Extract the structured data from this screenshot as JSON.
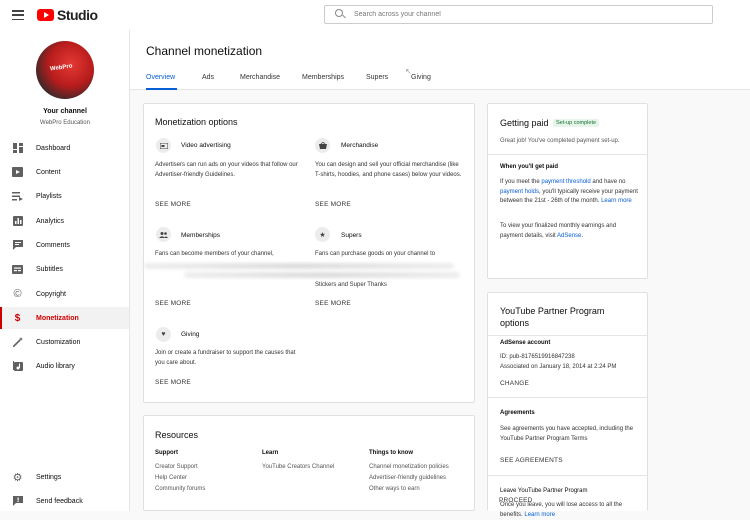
{
  "app": {
    "logo_text": "Studio"
  },
  "search": {
    "placeholder": "Search across your channel"
  },
  "channel": {
    "name": "Your channel",
    "subtitle": "WebPro Education",
    "avatar_text": "WebPro"
  },
  "sidebar": {
    "items": [
      {
        "label": "Dashboard",
        "icon": "dashboard-icon"
      },
      {
        "label": "Content",
        "icon": "content-icon"
      },
      {
        "label": "Playlists",
        "icon": "playlists-icon"
      },
      {
        "label": "Analytics",
        "icon": "analytics-icon"
      },
      {
        "label": "Comments",
        "icon": "comments-icon"
      },
      {
        "label": "Subtitles",
        "icon": "subtitles-icon"
      },
      {
        "label": "Copyright",
        "icon": "copyright-icon"
      },
      {
        "label": "Monetization",
        "icon": "dollar-icon",
        "active": true
      },
      {
        "label": "Customization",
        "icon": "magic-wand-icon"
      },
      {
        "label": "Audio library",
        "icon": "audio-library-icon"
      }
    ],
    "bottom": [
      {
        "label": "Settings",
        "icon": "gear-icon"
      },
      {
        "label": "Send feedback",
        "icon": "feedback-icon"
      }
    ]
  },
  "page": {
    "title": "Channel monetization"
  },
  "tabs": [
    "Overview",
    "Ads",
    "Merchandise",
    "Memberships",
    "Supers",
    "Giving"
  ],
  "monetization": {
    "title": "Monetization options",
    "options": [
      {
        "title": "Video advertising",
        "desc": "Advertisers can run ads on your videos that follow our Advertiser-friendly Guidelines.",
        "action": "SEE MORE"
      },
      {
        "title": "Merchandise",
        "desc": "You can design and sell your official merchandise (like T-shirts, hoodies, and phone cases) below your videos.",
        "action": "SEE MORE"
      },
      {
        "title": "Memberships",
        "desc": "Fans can become members of your channel,",
        "action": "SEE MORE"
      },
      {
        "title": "Supers",
        "desc": "Fans can purchase goods on your channel to",
        "desc2": "Stickers and Super Thanks",
        "action": "SEE MORE"
      },
      {
        "title": "Giving",
        "desc": "Join or create a fundraiser to support the causes that you care about.",
        "action": "SEE MORE"
      }
    ]
  },
  "resources": {
    "title": "Resources",
    "columns": [
      {
        "title": "Support",
        "links": [
          "Creator Support",
          "Help Center",
          "Community forums"
        ]
      },
      {
        "title": "Learn",
        "links": [
          "YouTube Creators Channel"
        ]
      },
      {
        "title": "Things to know",
        "links": [
          "Channel monetization policies",
          "Advertiser-friendly guidelines",
          "Other ways to earn"
        ]
      }
    ]
  },
  "getting_paid": {
    "title": "Getting paid",
    "badge": "Set-up complete",
    "intro": "Great job! You've completed payment set-up.",
    "when_title": "When you'll get paid",
    "when_pre": "If you meet the ",
    "when_link1": "payment threshold",
    "when_mid1": " and have no ",
    "when_link2": "payment holds",
    "when_mid2": ", you'll typically receive your payment between the 21st - 26th of the month. ",
    "when_link3": "Learn more",
    "view_pre": "To view your finalized monthly earnings and payment details, visit ",
    "view_link": "AdSense",
    "view_post": "."
  },
  "ypp": {
    "title": "YouTube Partner Program options",
    "adsense_title": "AdSense account",
    "adsense_id": "ID: pub-8176519916847238",
    "adsense_assoc": "Associated on January 18, 2014 at 2:24 PM",
    "adsense_action": "CHANGE",
    "agreements_title": "Agreements",
    "agreements_desc": "See agreements you have accepted, including the YouTube Partner Program Terms",
    "agreements_action": "SEE AGREEMENTS",
    "leave_title": "Leave YouTube Partner Program",
    "leave_desc": "Once you leave, you will lose access to all the benefits. ",
    "leave_link": "Learn more",
    "leave_action": "PROCEED"
  }
}
